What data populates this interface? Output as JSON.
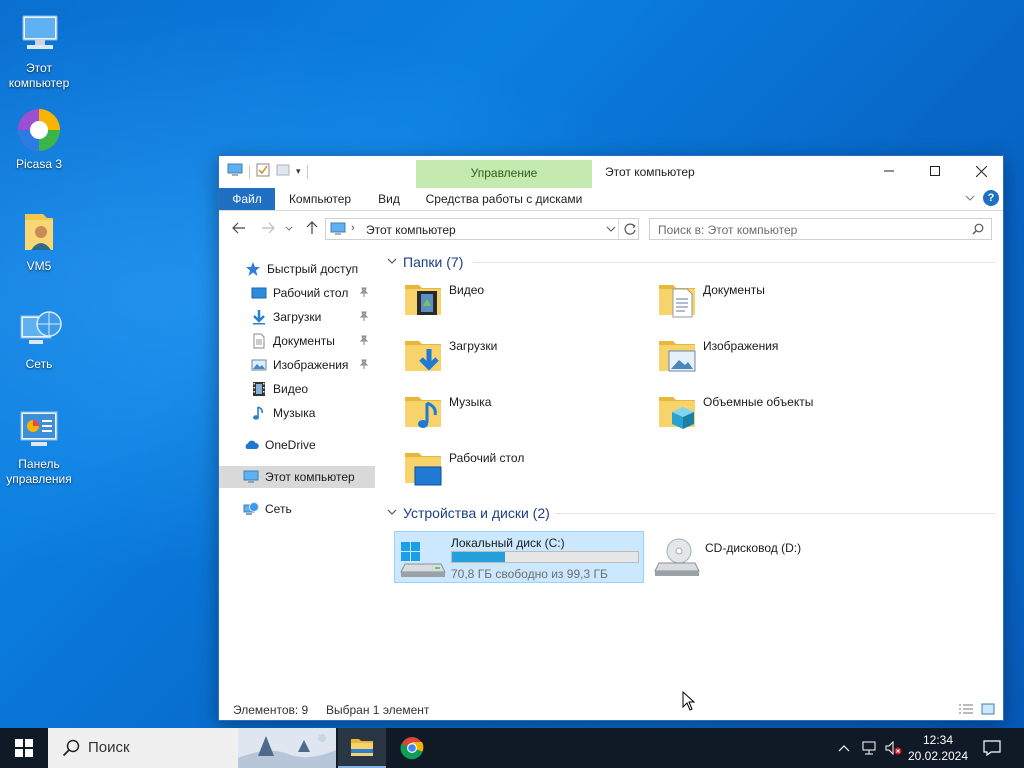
{
  "desktop": {
    "icons": [
      {
        "label": "Этот компьютер"
      },
      {
        "label": "Picasa 3"
      },
      {
        "label": "VM5"
      },
      {
        "label": "Сеть"
      },
      {
        "label": "Панель управления"
      }
    ]
  },
  "window": {
    "title": "Этот компьютер",
    "ribbon_context_header": "Управление",
    "tabs": {
      "file": "Файл",
      "computer": "Компьютер",
      "view": "Вид",
      "disk_tools": "Средства работы с дисками"
    },
    "address": "Этот компьютер",
    "search_placeholder": "Поиск в: Этот компьютер",
    "help_label": "?"
  },
  "nav_pane": {
    "quick_access": "Быстрый доступ",
    "quick_items": [
      {
        "label": "Рабочий стол"
      },
      {
        "label": "Загрузки"
      },
      {
        "label": "Документы"
      },
      {
        "label": "Изображения"
      },
      {
        "label": "Видео"
      },
      {
        "label": "Музыка"
      }
    ],
    "onedrive": "OneDrive",
    "this_pc": "Этот компьютер",
    "network": "Сеть"
  },
  "content": {
    "folders_header": "Папки (7)",
    "folders": [
      {
        "label": "Видео"
      },
      {
        "label": "Документы"
      },
      {
        "label": "Загрузки"
      },
      {
        "label": "Изображения"
      },
      {
        "label": "Музыка"
      },
      {
        "label": "Объемные объекты"
      },
      {
        "label": "Рабочий стол"
      }
    ],
    "devices_header": "Устройства и диски (2)",
    "drives": [
      {
        "label": "Локальный диск (C:)",
        "free_text": "70,8 ГБ свободно из 99,3 ГБ",
        "used_fraction": 0.287
      },
      {
        "label": "CD-дисковод (D:)"
      }
    ]
  },
  "status": {
    "items_count": "Элементов: 9",
    "selected": "Выбран 1 элемент"
  },
  "taskbar": {
    "search_placeholder": "Поиск",
    "time": "12:34",
    "date": "20.02.2024"
  },
  "colors": {
    "accent": "#1f6fc2",
    "ribbon_context": "#c4eab0",
    "selection": "#cce8ff",
    "drive_bar": "#26a0da",
    "taskbar": "#101a27"
  }
}
